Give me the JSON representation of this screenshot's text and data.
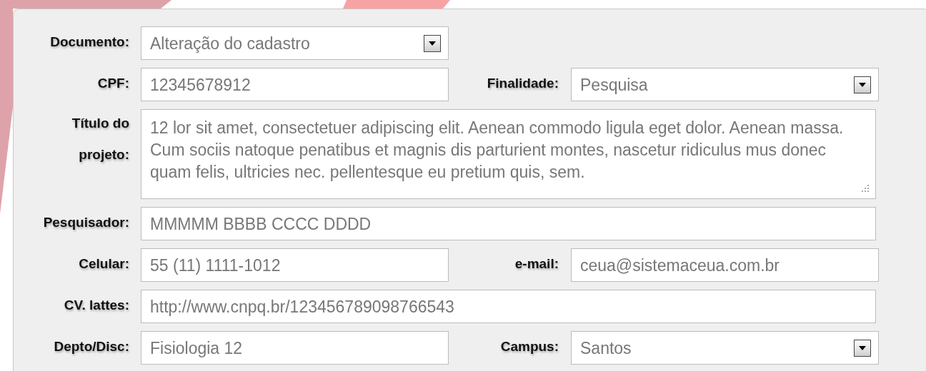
{
  "form": {
    "rows": [
      {
        "fields": [
          {
            "label": "Documento:",
            "kind": "select",
            "value": "Alteração do cadastro"
          }
        ]
      },
      {
        "fields": [
          {
            "label": "CPF:",
            "kind": "text",
            "value": "12345678912"
          },
          {
            "label": "Finalidade:",
            "kind": "select",
            "value": "Pesquisa"
          }
        ]
      },
      {
        "fields": [
          {
            "label": "Título do projeto:",
            "kind": "textarea",
            "value": "12 lor sit amet, consectetuer adipiscing elit. Aenean commodo ligula eget dolor. Aenean massa. Cum sociis natoque penatibus et magnis dis parturient montes, nascetur ridiculus mus donec quam felis, ultricies nec. pellentesque eu pretium quis, sem."
          }
        ]
      },
      {
        "fields": [
          {
            "label": "Pesquisador:",
            "kind": "text",
            "value": "MMMMM BBBB CCCC DDDD"
          }
        ]
      },
      {
        "fields": [
          {
            "label": "Celular:",
            "kind": "text",
            "value": "55 (11) 1111-1012"
          },
          {
            "label": "e-mail:",
            "kind": "text",
            "value": "ceua@sistemaceua.com.br"
          }
        ]
      },
      {
        "fields": [
          {
            "label": "CV. lattes:",
            "kind": "text",
            "value": "http://www.cnpq.br/123456789098766543"
          }
        ]
      },
      {
        "fields": [
          {
            "label": "Depto/Disc:",
            "kind": "text",
            "value": "Fisiologia 12"
          },
          {
            "label": "Campus:",
            "kind": "select",
            "value": "Santos"
          }
        ]
      }
    ]
  }
}
